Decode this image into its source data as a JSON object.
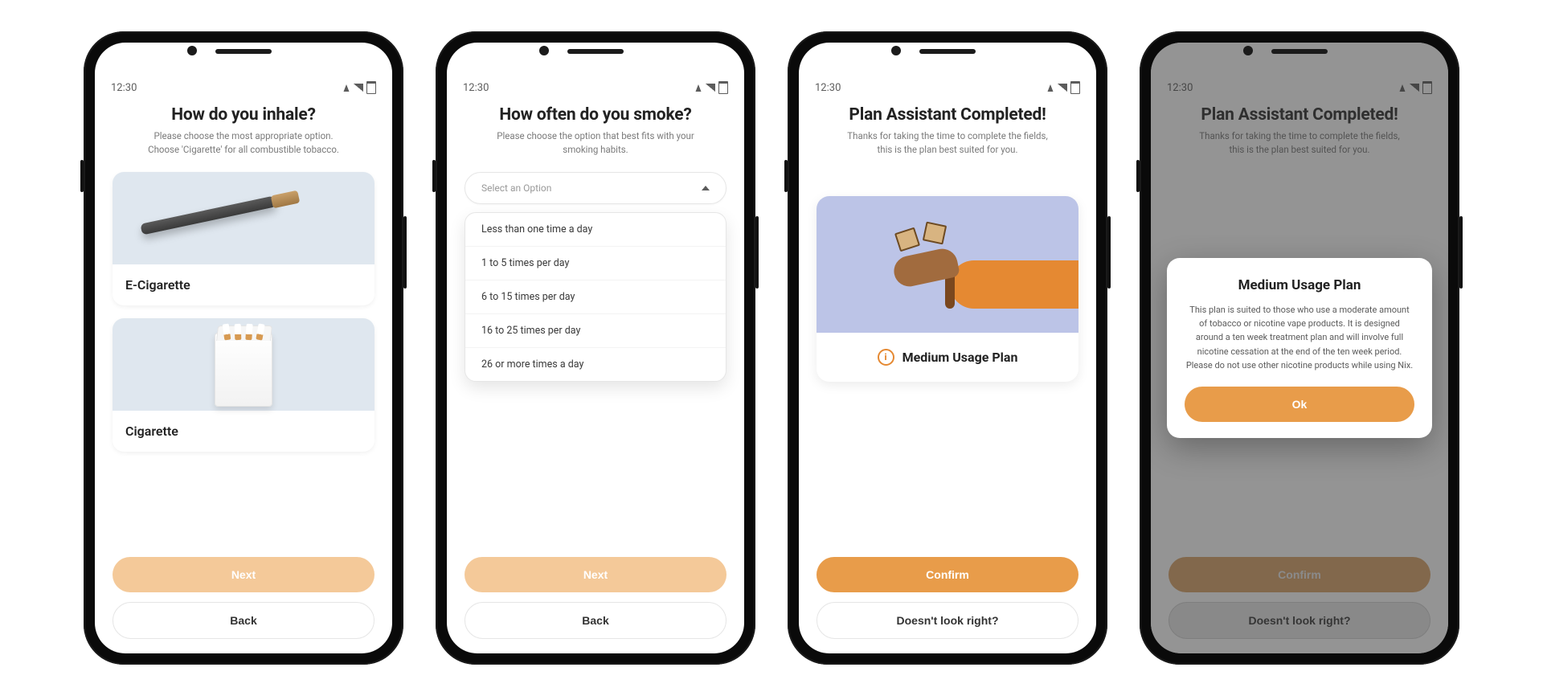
{
  "status": {
    "time": "12:30"
  },
  "colors": {
    "accent": "#e89c4a",
    "accent_faded": "#f4c999",
    "tile": "#dfe7ef",
    "illus": "#bcc4e7"
  },
  "screen1": {
    "title": "How do you inhale?",
    "subtitle": "Please choose the most appropriate option. Choose 'Cigarette' for all combustible tobacco.",
    "options": [
      {
        "label": "E-Cigarette",
        "icon": "ecig-icon"
      },
      {
        "label": "Cigarette",
        "icon": "cigarette-pack-icon"
      }
    ],
    "primary": "Next",
    "secondary": "Back"
  },
  "screen2": {
    "title": "How often do you smoke?",
    "subtitle": "Please choose the option that best fits with your smoking habits.",
    "select_placeholder": "Select an Option",
    "dropdown_items": [
      "Less than one time a day",
      "1 to 5 times per day",
      "6 to 15 times per day",
      "16 to 25 times per day",
      "26 or more times a day"
    ],
    "primary": "Next",
    "secondary": "Back"
  },
  "screen3": {
    "title": "Plan Assistant Completed!",
    "subtitle": "Thanks for taking the time to complete the fields, this is the plan best suited for you.",
    "plan_name": "Medium Usage Plan",
    "primary": "Confirm",
    "secondary": "Doesn't look right?"
  },
  "screen4": {
    "title": "Plan Assistant Completed!",
    "subtitle": "Thanks for taking the time to complete the fields, this is the plan best suited for you.",
    "primary": "Confirm",
    "secondary": "Doesn't look right?",
    "modal": {
      "title": "Medium Usage Plan",
      "body": "This plan is suited to those who use a moderate amount of tobacco or nicotine vape products. It is designed around a ten week treatment plan and will involve full nicotine cessation at the end of the ten week period. Please do not use other nicotine products while using Nix.",
      "ok": "Ok"
    }
  }
}
